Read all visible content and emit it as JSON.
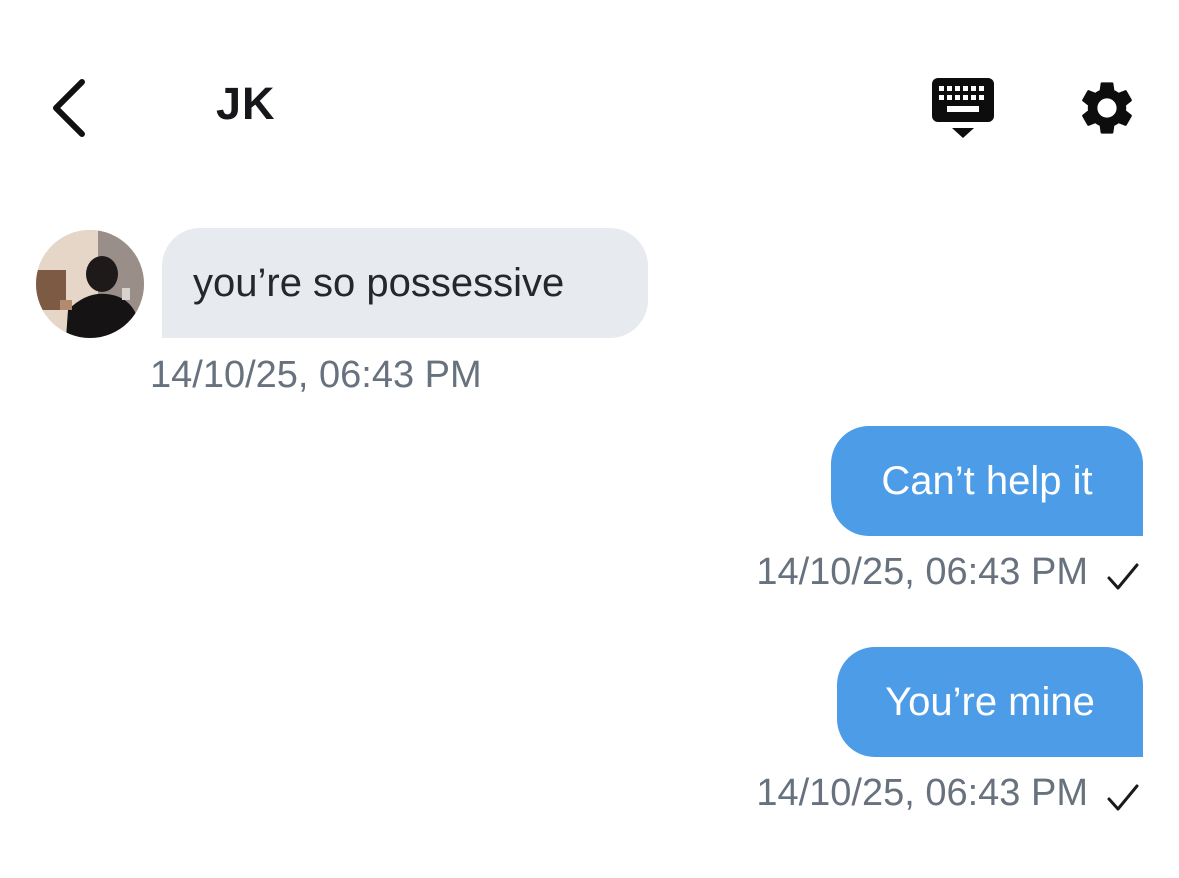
{
  "header": {
    "title": "JK",
    "back_icon": "chevron-left-icon",
    "keyboard_icon": "keyboard-hide-icon",
    "settings_icon": "gear-icon"
  },
  "messages": [
    {
      "direction": "incoming",
      "text": "you’re so possessive",
      "timestamp": "14/10/25, 06:43 PM"
    },
    {
      "direction": "outgoing",
      "text": "Can’t help it",
      "timestamp": "14/10/25, 06:43 PM",
      "status_icon": "check-icon"
    },
    {
      "direction": "outgoing",
      "text": "You’re mine",
      "timestamp": "14/10/25, 06:43 PM",
      "status_icon": "check-icon"
    }
  ],
  "colors": {
    "incoming_bubble": "#e7ebf0",
    "outgoing_bubble": "#4c9ce8",
    "timestamp": "#67727e",
    "title": "#15171a"
  }
}
